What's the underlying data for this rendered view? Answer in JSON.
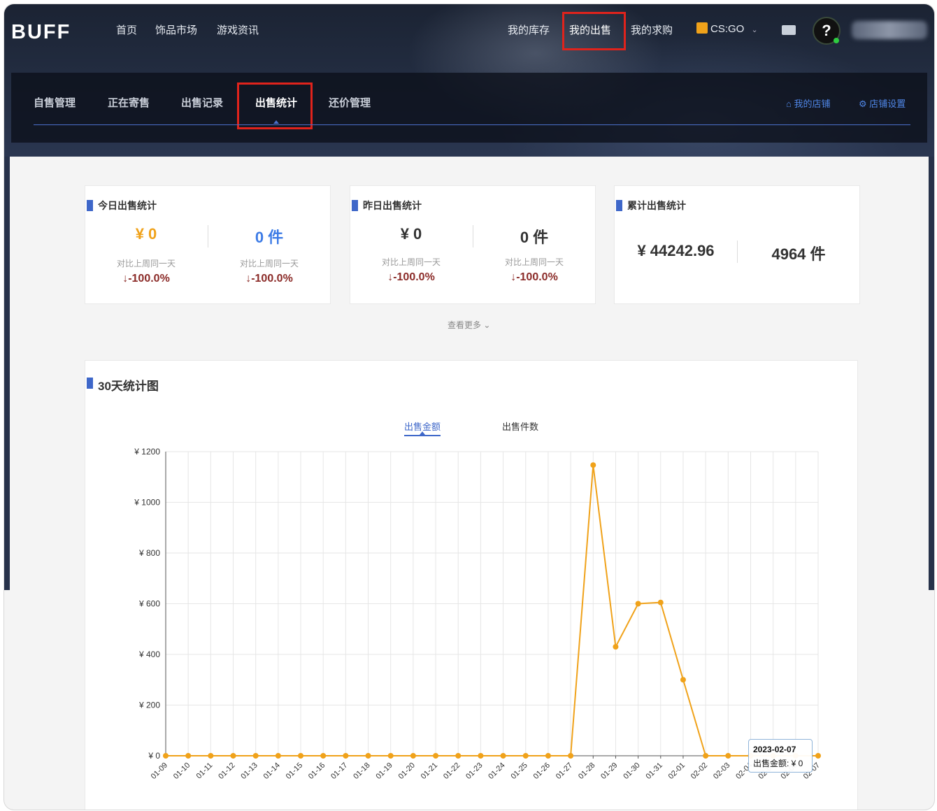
{
  "header": {
    "logo": "BUFF",
    "nav_left": [
      "首页",
      "饰品市场",
      "游戏资讯"
    ],
    "nav_right": [
      "我的库存",
      "我的出售",
      "我的求购"
    ],
    "game": "CS:GO",
    "help": "?"
  },
  "subnav": {
    "tabs": [
      "自售管理",
      "正在寄售",
      "出售记录",
      "出售统计",
      "还价管理"
    ],
    "active": "出售统计",
    "my_shop": "我的店铺",
    "shop_settings": "店铺设置"
  },
  "cards": {
    "today": {
      "title": "今日出售统计",
      "amount": "¥ 0",
      "count": "0 件",
      "compare_label": "对比上周同一天",
      "amount_change": "↓-100.0%",
      "count_change": "↓-100.0%"
    },
    "yesterday": {
      "title": "昨日出售统计",
      "amount": "¥ 0",
      "count": "0 件",
      "compare_label": "对比上周同一天",
      "amount_change": "↓-100.0%",
      "count_change": "↓-100.0%"
    },
    "total": {
      "title": "累计出售统计",
      "amount": "¥ 44242.96",
      "count": "4964 件"
    },
    "more": "查看更多"
  },
  "chart_section": {
    "title": "30天统计图",
    "tabs": [
      "出售金额",
      "出售件数"
    ],
    "active_tab": "出售金额",
    "tooltip": {
      "date": "2023-02-07",
      "label": "出售金额: ¥ 0"
    }
  },
  "colors": {
    "accent": "#3e67c9",
    "line": "#f0a21a",
    "highlight": "#e0231c",
    "negative": "#8b2b28"
  },
  "chart_data": {
    "type": "line",
    "title": "30天统计图",
    "categories": [
      "01-09",
      "01-10",
      "01-11",
      "01-12",
      "01-13",
      "01-14",
      "01-15",
      "01-16",
      "01-17",
      "01-18",
      "01-19",
      "01-20",
      "01-21",
      "01-22",
      "01-23",
      "01-24",
      "01-25",
      "01-26",
      "01-27",
      "01-28",
      "01-29",
      "01-30",
      "01-31",
      "02-01",
      "02-02",
      "02-03",
      "02-04",
      "02-05",
      "02-06",
      "02-07"
    ],
    "series": [
      {
        "name": "出售金额",
        "values": [
          0,
          0,
          0,
          0,
          0,
          0,
          0,
          0,
          0,
          0,
          0,
          0,
          0,
          0,
          0,
          0,
          0,
          0,
          0,
          1147,
          430,
          600,
          605,
          300,
          0,
          0,
          0,
          0,
          0,
          0
        ]
      }
    ],
    "yticks": [
      "¥ 0",
      "¥ 200",
      "¥ 400",
      "¥ 600",
      "¥ 800",
      "¥ 1000",
      "¥ 1200"
    ],
    "ylim": [
      0,
      1200
    ],
    "grid": true
  }
}
